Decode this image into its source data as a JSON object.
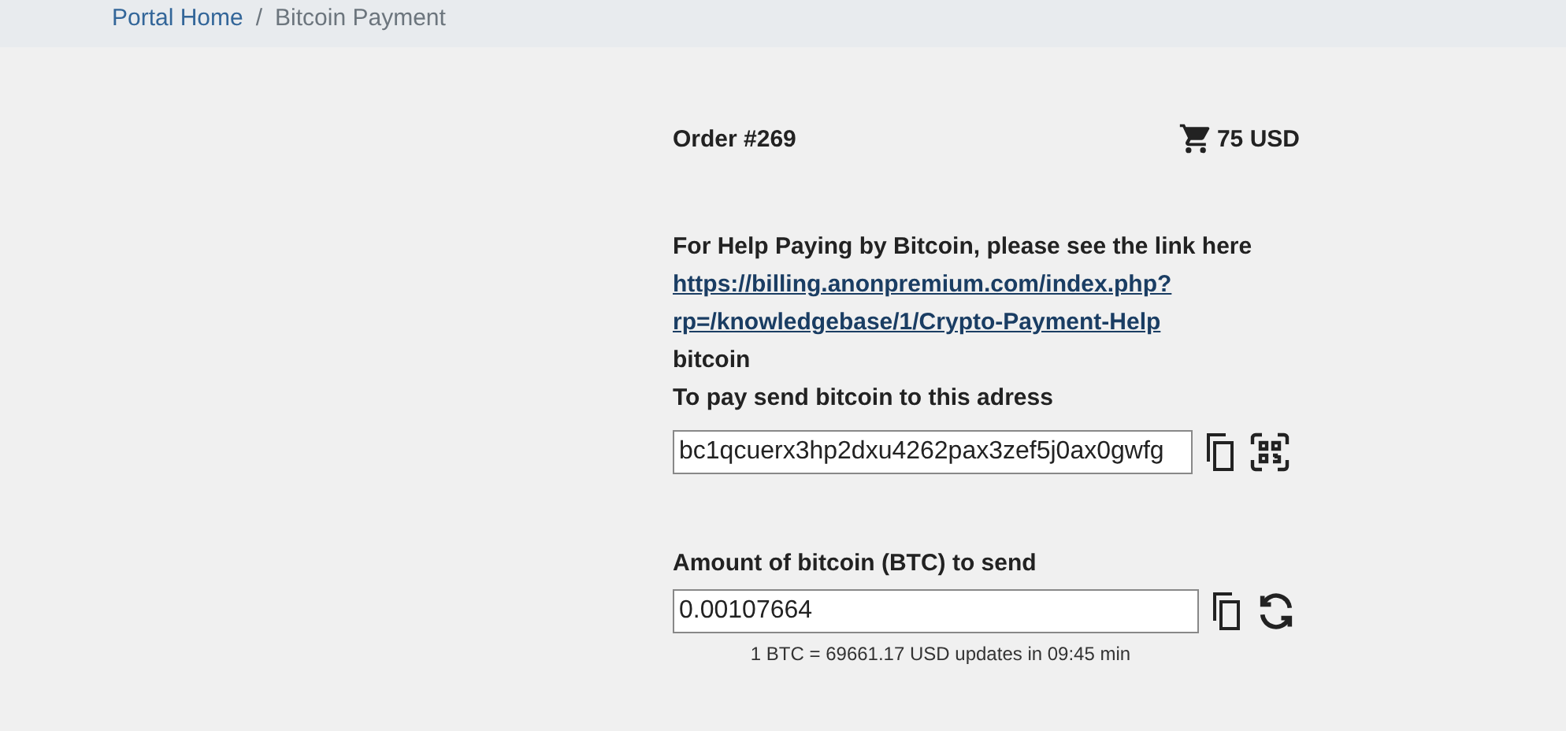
{
  "breadcrumb_separator": "/",
  "breadcrumb": [
    {
      "label": "Portal Home",
      "link": true
    },
    {
      "label": "Bitcoin Payment",
      "link": false
    }
  ],
  "order": {
    "title": "Order #269",
    "total": "75 USD"
  },
  "help": {
    "text": "For Help Paying by Bitcoin, please see the link here",
    "link_lines": [
      "https://billing.anonpremium.com/index.php?",
      "rp=/knowledgebase/1/Crypto-Payment-Help"
    ],
    "coin": "bitcoin",
    "address_label": "To pay send bitcoin to this adress"
  },
  "address": {
    "value": "bc1qcuerx3hp2dxu4262pax3zef5j0ax0gwfg"
  },
  "amount": {
    "label": "Amount of bitcoin (BTC) to send",
    "value": "0.00107664",
    "rate_note": "1 BTC = 69661.17 USD updates in 09:45 min"
  }
}
